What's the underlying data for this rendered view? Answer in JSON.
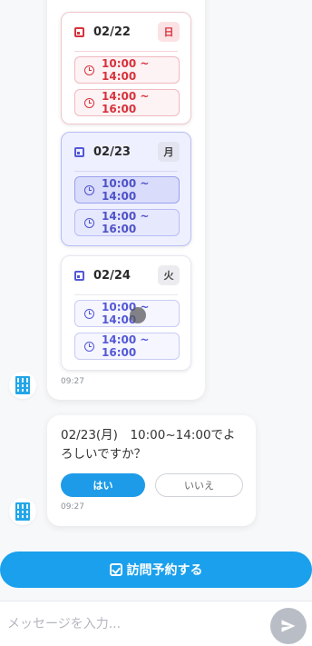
{
  "schedule": {
    "days": [
      {
        "date": "02/22",
        "weekday": "日",
        "slots": [
          "10:00 ~ 14:00",
          "14:00 ~ 16:00"
        ]
      },
      {
        "date": "02/23",
        "weekday": "月",
        "slots": [
          "10:00 ~ 14:00",
          "14:00 ~ 16:00"
        ],
        "selected_slot": "10:00 ~ 14:00"
      },
      {
        "date": "02/24",
        "weekday": "火",
        "slots": [
          "10:00 ~ 14:00",
          "14:00 ~ 16:00"
        ]
      }
    ],
    "timestamp": "09:27"
  },
  "confirm": {
    "text": "02/23(月)　10:00~14:00でよろしいですか？",
    "yes_label": "はい",
    "no_label": "いいえ",
    "timestamp": "09:27"
  },
  "actions": {
    "visit_label": "訪問予約する"
  },
  "composer": {
    "placeholder": "メッセージを入力..."
  },
  "icons": {
    "bot": "building-icon",
    "calendar": "calendar-icon",
    "clock": "clock-icon",
    "send": "send-icon",
    "visit": "calendar-check-icon"
  },
  "colors": {
    "primary": "#1e9be8",
    "sunday": "#d8323c",
    "selected": "#5458d6"
  }
}
